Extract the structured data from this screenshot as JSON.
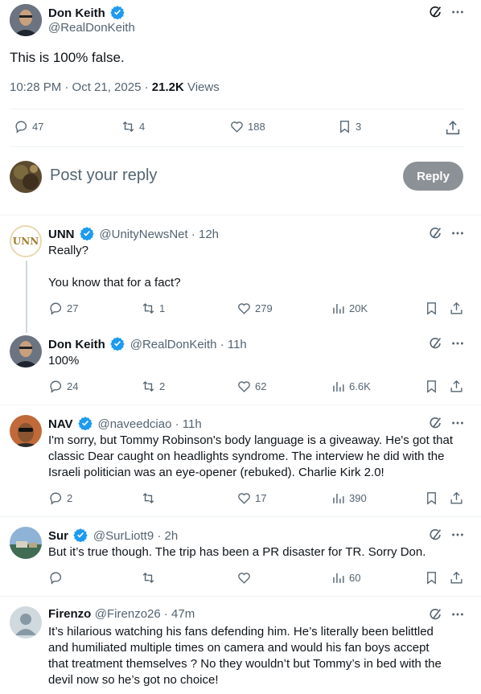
{
  "main_post": {
    "name": "Don Keith",
    "handle": "@RealDonKeith",
    "text": "This is 100% false.",
    "time": "10:28 PM · Oct 21, 2025 · ",
    "views_count": "21.2K",
    "views_label": " Views",
    "replies": "47",
    "reposts": "4",
    "likes": "188",
    "bookmarks": "3"
  },
  "composer": {
    "placeholder": "Post your reply",
    "reply_button": "Reply"
  },
  "replies": [
    {
      "name": "UNN",
      "handle": "@UnityNewsNet · 12h",
      "text_lines": [
        "Really?",
        "",
        "You know that for a fact?"
      ],
      "replies": "27",
      "reposts": "1",
      "likes": "279",
      "views": "20K"
    },
    {
      "name": "Don Keith",
      "handle": "@RealDonKeith · 11h",
      "text_lines": [
        "100%"
      ],
      "replies": "24",
      "reposts": "2",
      "likes": "62",
      "views": "6.6K"
    },
    {
      "name": "NAV",
      "handle": "@naveedciao · 11h",
      "text_lines": [
        "I'm sorry, but Tommy Robinson's body language is a giveaway. He's got that",
        "classic Dear caught on headlights syndrome. The interview he did with the",
        "Israeli politician was an eye-opener (rebuked). Charlie Kirk 2.0!"
      ],
      "replies": "2",
      "reposts": "",
      "likes": "17",
      "views": "390"
    },
    {
      "name": "Sur",
      "handle": "@SurLiott9 · 2h",
      "text_lines": [
        "But it’s true though. The trip has been a PR disaster for TR. Sorry Don."
      ],
      "replies": "",
      "reposts": "",
      "likes": "",
      "views": "60"
    },
    {
      "name": "Firenzo",
      "handle": "@Firenzo26 · 47m",
      "text_lines": [
        "It’s hilarious watching his fans defending him. He’s literally been belittled",
        "and humiliated multiple times on camera and would his fan boys accept",
        "that treatment themselves ? No they wouldn’t but Tommy’s in bed with the",
        "devil now so he’s got no choice!"
      ]
    }
  ],
  "unn_logo_text": "UNN",
  "colors": {
    "verified": "#1d9bf0",
    "secondary": "#536471",
    "reply_button_bg": "#8b9196"
  }
}
